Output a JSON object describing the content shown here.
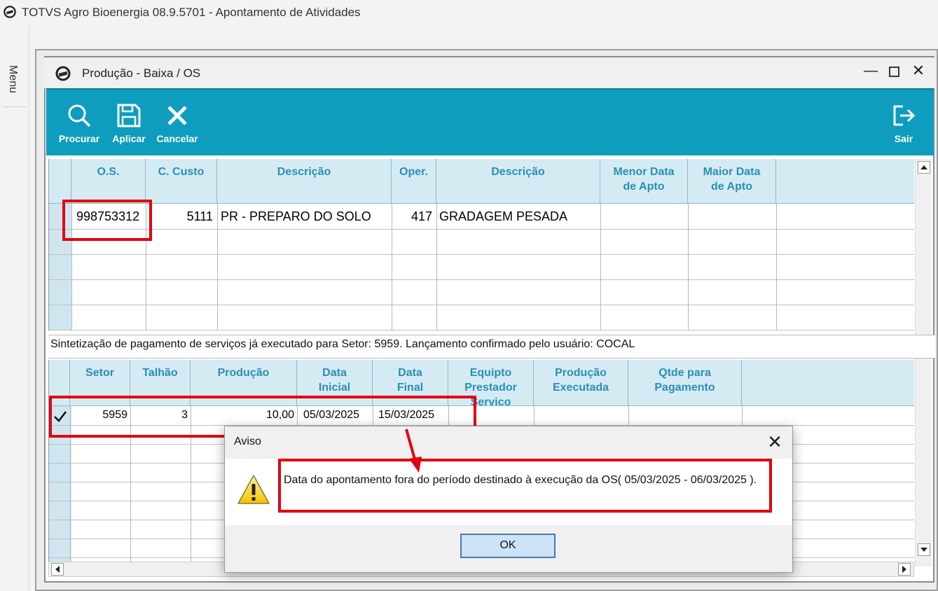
{
  "app": {
    "title": "TOTVS Agro Bioenergia 08.9.5701 - Apontamento de Atividades",
    "menu_label": "Menu"
  },
  "window": {
    "title": "Produção - Baixa / OS"
  },
  "toolbar": {
    "search_label": "Procurar",
    "apply_label": "Aplicar",
    "cancel_label": "Cancelar",
    "exit_label": "Sair"
  },
  "grid_os": {
    "columns": [
      "O.S.",
      "C. Custo",
      "Descrição",
      "Oper.",
      "Descrição",
      "Menor Data de Apto",
      "Maior Data de Apto"
    ],
    "rows": [
      {
        "os": "998753312",
        "custo": "5111",
        "descricao": "PR - PREPARO DO SOLO",
        "oper": "417",
        "descricao_oper": "GRADAGEM PESADA",
        "menor_data": "",
        "maior_data": ""
      }
    ]
  },
  "status": {
    "text": "Sintetização de pagamento de serviços já executado para Setor:  5959. Lançamento confirmado pelo usuário: COCAL"
  },
  "grid_prod": {
    "columns": [
      "Setor",
      "Talhão",
      "Produção",
      "Data Inicial",
      "Data Final",
      "Equipto Prestador Serviço",
      "Produção Executada",
      "Qtde para Pagamento"
    ],
    "rows": [
      {
        "setor": "5959",
        "talhao": "3",
        "producao": "10,00",
        "data_inicial": "05/03/2025",
        "data_final": "15/03/2025",
        "equipto": "",
        "prod_exec": "",
        "qtde": ""
      }
    ]
  },
  "dialog": {
    "title": "Aviso",
    "message": "Data do apontamento fora do período destinado à execução da OS( 05/03/2025 - 06/03/2025 ).",
    "ok_label": "OK"
  },
  "colors": {
    "toolbar": "#0e9dbe",
    "header_text": "#2a8fb4",
    "highlight": "#e3000f"
  }
}
